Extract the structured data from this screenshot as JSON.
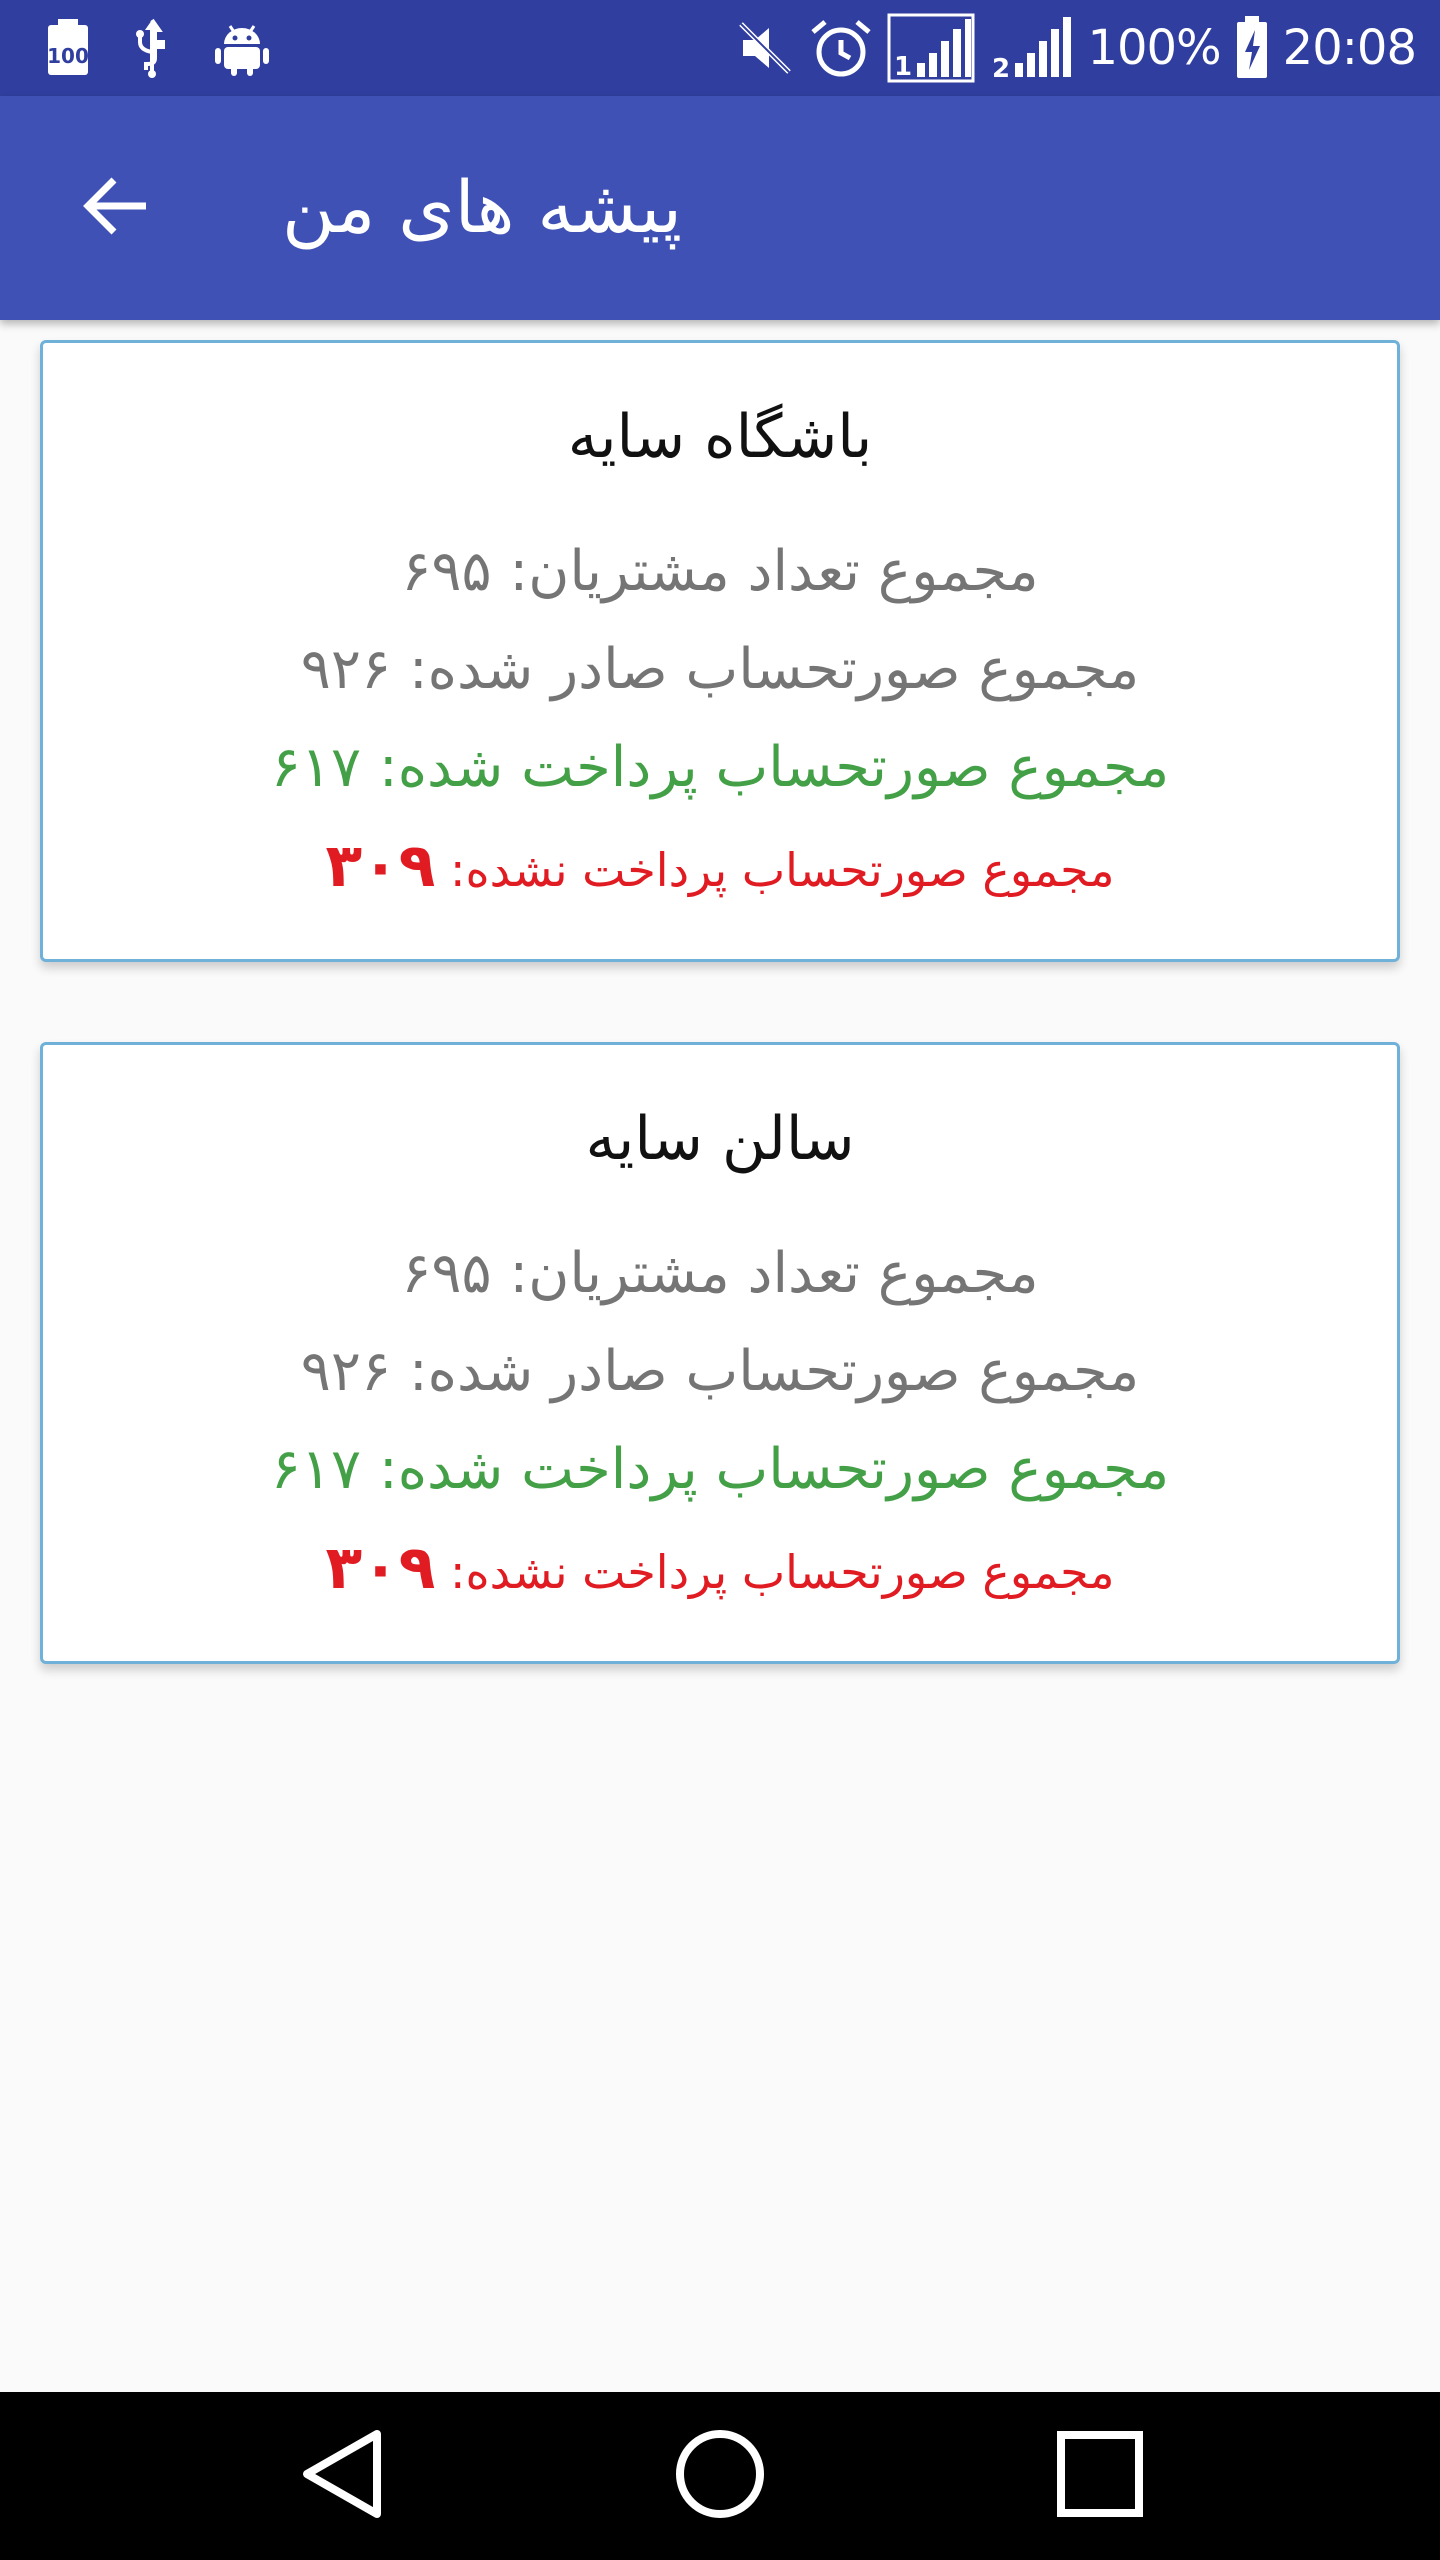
{
  "status_bar": {
    "battery_percent": "100%",
    "time": "20:08",
    "icons": [
      "battery-100-notification-icon",
      "usb-icon",
      "android-debug-icon",
      "mute-icon",
      "alarm-icon",
      "signal-sim1-icon",
      "signal-sim2-icon",
      "battery-charging-icon"
    ]
  },
  "app_bar": {
    "title": "پیشه های من",
    "back_icon": "arrow-back-icon"
  },
  "cards": [
    {
      "title": "باشگاه سایه",
      "customers_label": "مجموع تعداد مشتریان: ",
      "customers_value": "۶۹۵",
      "issued_label": "مجموع صورتحساب صادر شده: ",
      "issued_value": "۹۲۶",
      "paid_label": "مجموع صورتحساب پرداخت شده: ",
      "paid_value": "۶۱۷",
      "unpaid_label": "مجموع صورتحساب پرداخت نشده: ",
      "unpaid_value": "۳۰۹"
    },
    {
      "title": "سالن سایه",
      "customers_label": "مجموع تعداد مشتریان: ",
      "customers_value": "۶۹۵",
      "issued_label": "مجموع صورتحساب صادر شده: ",
      "issued_value": "۹۲۶",
      "paid_label": "مجموع صورتحساب پرداخت شده: ",
      "paid_value": "۶۱۷",
      "unpaid_label": "مجموع صورتحساب پرداخت نشده: ",
      "unpaid_value": "۳۰۹"
    }
  ],
  "colors": {
    "status_bar": "#303f9f",
    "app_bar": "#3f51b5",
    "card_border": "#6fb1d8",
    "paid_text": "#43a047",
    "unpaid_text": "#e11b22",
    "secondary_text": "#757575"
  },
  "nav_bar": {
    "icons": [
      "nav-back-icon",
      "nav-home-icon",
      "nav-recent-apps-icon"
    ]
  }
}
